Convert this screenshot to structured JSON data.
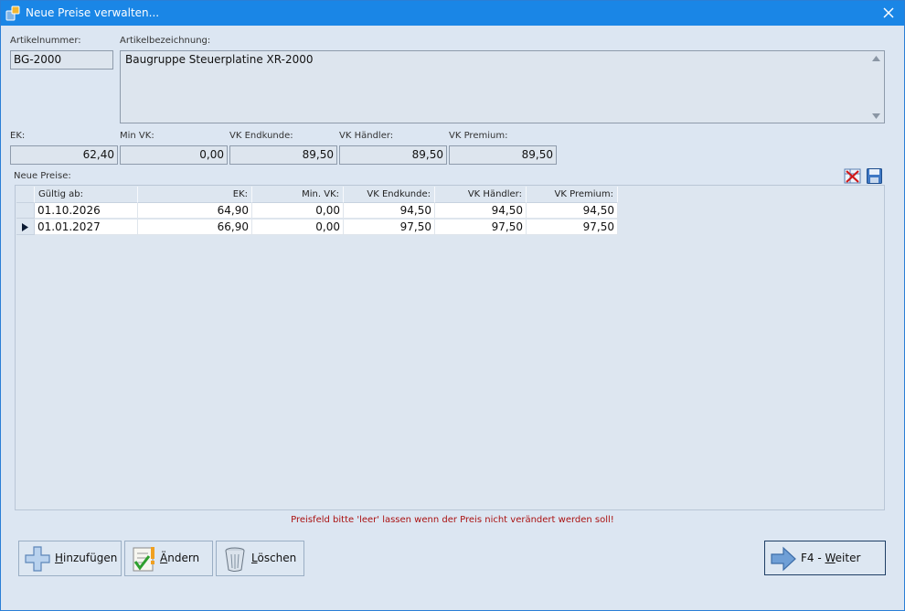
{
  "window": {
    "title": "Neue Preise verwalten..."
  },
  "article": {
    "number_label": "Artikelnummer:",
    "number_value": "BG-2000",
    "description_label": "Artikelbezeichnung:",
    "description_value": "Baugruppe Steuerplatine XR-2000"
  },
  "prices": [
    {
      "label": "EK:",
      "value": "62,40"
    },
    {
      "label": "Min VK:",
      "value": "0,00"
    },
    {
      "label": "VK Endkunde:",
      "value": "89,50"
    },
    {
      "label": "VK Händler:",
      "value": "89,50"
    },
    {
      "label": "VK Premium:",
      "value": "89,50"
    }
  ],
  "new_prices": {
    "label": "Neue Preise:",
    "columns": [
      "Gültig ab:",
      "EK:",
      "Min. VK:",
      "VK Endkunde:",
      "VK Händler:",
      "VK Premium:"
    ],
    "rows": [
      [
        "01.10.2026",
        "64,90",
        "0,00",
        "94,50",
        "94,50",
        "94,50"
      ],
      [
        "01.01.2027",
        "66,90",
        "0,00",
        "97,50",
        "97,50",
        "97,50"
      ]
    ],
    "current_row": 2
  },
  "hint": "Preisfeld bitte 'leer' lassen wenn der Preis nicht verändert werden soll!",
  "buttons": {
    "add": {
      "mnemonic": "H",
      "rest": "inzufügen"
    },
    "edit": {
      "mnemonic": "Ä",
      "rest": "ndern"
    },
    "delete": {
      "mnemonic": "L",
      "rest": "öschen"
    },
    "next": {
      "prefix": "F4 - ",
      "mnemonic": "W",
      "rest": "eiter"
    }
  },
  "icons": {
    "app": "app-icon",
    "close": "close-icon",
    "clear": "delete-grid-icon",
    "save": "save-disk-icon",
    "add": "plus-icon",
    "edit": "checklist-icon",
    "delete": "trash-icon",
    "next": "arrow-right-icon"
  },
  "colors": {
    "titlebar": "#1a86e6",
    "hint": "#aa1111",
    "background": "#dce6f2"
  }
}
